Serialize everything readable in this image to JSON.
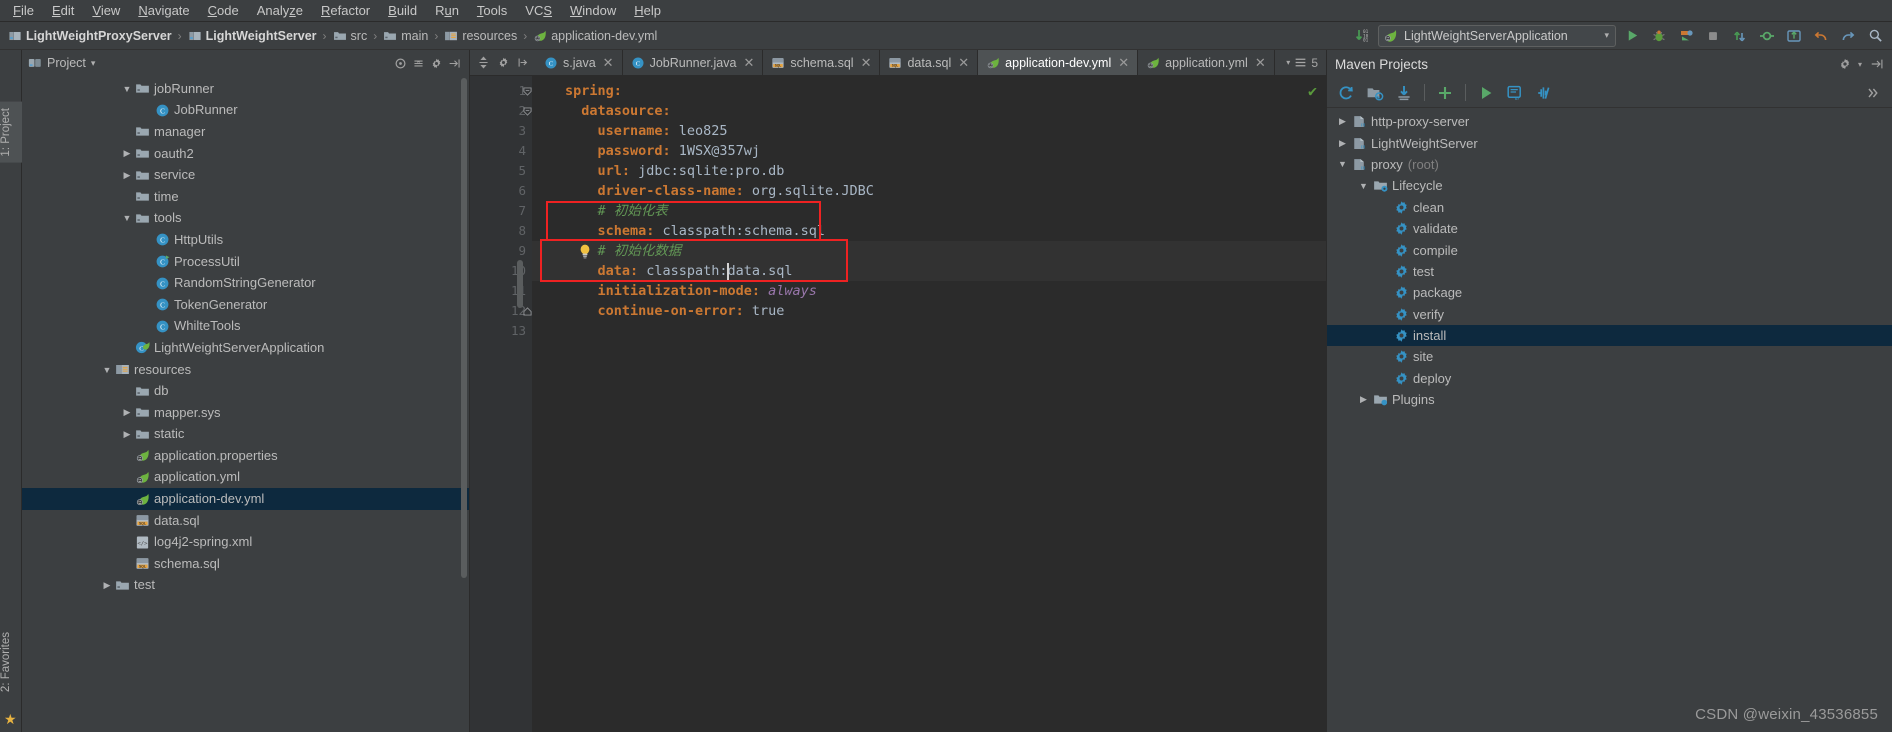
{
  "menu": {
    "items": [
      {
        "label": "File",
        "mnemonic": "F"
      },
      {
        "label": "Edit",
        "mnemonic": "E"
      },
      {
        "label": "View",
        "mnemonic": "V"
      },
      {
        "label": "Navigate",
        "mnemonic": "N"
      },
      {
        "label": "Code",
        "mnemonic": "C"
      },
      {
        "label": "Analyze",
        "mnemonic": "z"
      },
      {
        "label": "Refactor",
        "mnemonic": "R"
      },
      {
        "label": "Build",
        "mnemonic": "B"
      },
      {
        "label": "Run",
        "mnemonic": "u"
      },
      {
        "label": "Tools",
        "mnemonic": "T"
      },
      {
        "label": "VCS",
        "mnemonic": "S"
      },
      {
        "label": "Window",
        "mnemonic": "W"
      },
      {
        "label": "Help",
        "mnemonic": "H"
      }
    ]
  },
  "breadcrumb": {
    "items": [
      {
        "label": "LightWeightProxyServer",
        "icon": "module-icon",
        "bold": true
      },
      {
        "label": "LightWeightServer",
        "icon": "module-icon",
        "bold": true
      },
      {
        "label": "src",
        "icon": "folder-icon",
        "bold": false
      },
      {
        "label": "main",
        "icon": "folder-icon",
        "bold": false
      },
      {
        "label": "resources",
        "icon": "resources-folder-icon",
        "bold": false
      },
      {
        "label": "application-dev.yml",
        "icon": "spring-yml-icon",
        "bold": false
      }
    ],
    "separator": "›"
  },
  "toolbar": {
    "compile_icon": "compile-binary-icon",
    "run_config": {
      "name": "LightWeightServerApplication",
      "icon": "spring-boot-icon",
      "chevron": "▾"
    },
    "buttons": [
      {
        "name": "run-button",
        "icon": "play-icon",
        "color": "#5a9a3c"
      },
      {
        "name": "debug-button",
        "icon": "debug-icon",
        "color": "#cc7832"
      },
      {
        "name": "run-coverage-button",
        "icon": "coverage-icon",
        "color": "#cc7832"
      },
      {
        "name": "stop-button",
        "icon": "stop-icon",
        "color": "#8c8c8c"
      },
      {
        "name": "update-project-button",
        "icon": "vcs-update-icon",
        "color": "#499c54"
      },
      {
        "name": "commit-button",
        "icon": "vcs-commit-icon",
        "color": "#499c54"
      },
      {
        "name": "vcs-push-button",
        "icon": "vcs-push-icon",
        "color": "#6897bb"
      },
      {
        "name": "undo-button",
        "icon": "undo-icon",
        "color": "#cc7832"
      },
      {
        "name": "redo-button",
        "icon": "redo-icon",
        "color": "#6897bb"
      },
      {
        "name": "search-everywhere-button",
        "icon": "search-icon",
        "color": "#a9b7c6"
      }
    ]
  },
  "left_rail": {
    "tabs": [
      {
        "label": "1: Project",
        "active": true
      },
      {
        "label": "2: Favorites",
        "active": false
      }
    ],
    "bookmark_icon": "star-icon"
  },
  "project_panel": {
    "title": "Project",
    "chevron": "▾",
    "header_icons": [
      "settings-gear-icon",
      "collapse-all-icon",
      "options-gear-icon",
      "hide-panel-icon"
    ],
    "tree": [
      {
        "label": "jobRunner",
        "indent": 4,
        "arrow": "down",
        "icon": "folder"
      },
      {
        "label": "JobRunner",
        "indent": 5,
        "arrow": "none",
        "icon": "class"
      },
      {
        "label": "manager",
        "indent": 4,
        "arrow": "none",
        "icon": "folder"
      },
      {
        "label": "oauth2",
        "indent": 4,
        "arrow": "right",
        "icon": "folder"
      },
      {
        "label": "service",
        "indent": 4,
        "arrow": "right",
        "icon": "folder"
      },
      {
        "label": "time",
        "indent": 4,
        "arrow": "none",
        "icon": "folder"
      },
      {
        "label": "tools",
        "indent": 4,
        "arrow": "down",
        "icon": "folder"
      },
      {
        "label": "HttpUtils",
        "indent": 5,
        "arrow": "none",
        "icon": "class"
      },
      {
        "label": "ProcessUtil",
        "indent": 5,
        "arrow": "none",
        "icon": "class-run"
      },
      {
        "label": "RandomStringGenerator",
        "indent": 5,
        "arrow": "none",
        "icon": "class"
      },
      {
        "label": "TokenGenerator",
        "indent": 5,
        "arrow": "none",
        "icon": "class"
      },
      {
        "label": "WhilteTools",
        "indent": 5,
        "arrow": "none",
        "icon": "class"
      },
      {
        "label": "LightWeightServerApplication",
        "indent": 4,
        "arrow": "none",
        "icon": "spring-class"
      },
      {
        "label": "resources",
        "indent": 3,
        "arrow": "down",
        "icon": "resources-folder"
      },
      {
        "label": "db",
        "indent": 4,
        "arrow": "none",
        "icon": "folder"
      },
      {
        "label": "mapper.sys",
        "indent": 4,
        "arrow": "right",
        "icon": "folder"
      },
      {
        "label": "static",
        "indent": 4,
        "arrow": "right",
        "icon": "folder"
      },
      {
        "label": "application.properties",
        "indent": 4,
        "arrow": "none",
        "icon": "spring-file"
      },
      {
        "label": "application.yml",
        "indent": 4,
        "arrow": "none",
        "icon": "spring-file"
      },
      {
        "label": "application-dev.yml",
        "indent": 4,
        "arrow": "none",
        "icon": "spring-file",
        "selected": true
      },
      {
        "label": "data.sql",
        "indent": 4,
        "arrow": "none",
        "icon": "sql-file"
      },
      {
        "label": "log4j2-spring.xml",
        "indent": 4,
        "arrow": "none",
        "icon": "xml-file"
      },
      {
        "label": "schema.sql",
        "indent": 4,
        "arrow": "none",
        "icon": "sql-file"
      },
      {
        "label": "test",
        "indent": 3,
        "arrow": "right",
        "icon": "folder"
      }
    ]
  },
  "editor": {
    "tools": [
      "expand-collapse-icon",
      "settings-gear-icon",
      "select-opened-file-icon"
    ],
    "tabs": [
      {
        "label": "s.java",
        "icon": "java-class-icon",
        "active": false,
        "closable": true
      },
      {
        "label": "JobRunner.java",
        "icon": "java-class-icon",
        "active": false,
        "closable": true
      },
      {
        "label": "schema.sql",
        "icon": "sql-file-icon",
        "active": false,
        "closable": true
      },
      {
        "label": "data.sql",
        "icon": "sql-file-icon",
        "active": false,
        "closable": true
      },
      {
        "label": "application-dev.yml",
        "icon": "spring-yml-icon",
        "active": true,
        "closable": true
      },
      {
        "label": "application.yml",
        "icon": "spring-yml-icon",
        "active": false,
        "closable": true
      }
    ],
    "tab_overflow": {
      "chevron": "▾",
      "icon": "tab-list-icon",
      "count": "5"
    },
    "inspection_status": "ok",
    "inspection_glyph": "✔",
    "filename": "application-dev.yml",
    "lines": [
      {
        "num": "1",
        "indent": 0,
        "tokens": [
          {
            "t": "spring:",
            "c": "k"
          }
        ],
        "fold": "down"
      },
      {
        "num": "2",
        "indent": 1,
        "tokens": [
          {
            "t": "datasource:",
            "c": "k"
          }
        ],
        "fold": "down"
      },
      {
        "num": "3",
        "indent": 2,
        "tokens": [
          {
            "t": "username:",
            "c": "k"
          },
          {
            "t": " leo825",
            "c": "v"
          }
        ]
      },
      {
        "num": "4",
        "indent": 2,
        "tokens": [
          {
            "t": "password:",
            "c": "k"
          },
          {
            "t": " 1WSX@357wj",
            "c": "v"
          }
        ]
      },
      {
        "num": "5",
        "indent": 2,
        "tokens": [
          {
            "t": "url:",
            "c": "k"
          },
          {
            "t": " jdbc:sqlite:pro.db",
            "c": "v"
          }
        ]
      },
      {
        "num": "6",
        "indent": 2,
        "tokens": [
          {
            "t": "driver-class-name:",
            "c": "k"
          },
          {
            "t": " org.sqlite.JDBC",
            "c": "v"
          }
        ]
      },
      {
        "num": "7",
        "indent": 2,
        "tokens": [
          {
            "t": "# 初始化表",
            "c": "cm"
          }
        ]
      },
      {
        "num": "8",
        "indent": 2,
        "tokens": [
          {
            "t": "schema:",
            "c": "k"
          },
          {
            "t": " classpath:schema.sql",
            "c": "v"
          }
        ]
      },
      {
        "num": "9",
        "indent": 2,
        "tokens": [
          {
            "t": "# 初始化数据",
            "c": "cm"
          }
        ],
        "bulb": true,
        "highlight": true
      },
      {
        "num": "10",
        "indent": 2,
        "tokens": [
          {
            "t": "data:",
            "c": "k"
          },
          {
            "t": " classpath:data.sql",
            "c": "v"
          }
        ],
        "highlight": true,
        "caret_after": "data: classpath:"
      },
      {
        "num": "11",
        "indent": 2,
        "tokens": [
          {
            "t": "initialization-mode:",
            "c": "k"
          },
          {
            "t": " always",
            "c": "it"
          }
        ]
      },
      {
        "num": "12",
        "indent": 2,
        "tokens": [
          {
            "t": "continue-on-error:",
            "c": "k"
          },
          {
            "t": " true",
            "c": "v"
          }
        ],
        "fold": "up"
      },
      {
        "num": "13",
        "indent": 0,
        "tokens": []
      }
    ],
    "annotations": [
      {
        "name": "red-highlight-box-schema",
        "color": "#ee2222",
        "lines": "7-8"
      },
      {
        "name": "red-highlight-box-data",
        "color": "#ee2222",
        "lines": "9-10"
      }
    ]
  },
  "maven_panel": {
    "title": "Maven Projects",
    "header_icons": [
      "settings-gear-icon",
      "hide-panel-icon"
    ],
    "toolbar": [
      {
        "name": "reimport-button",
        "icon": "refresh-icon"
      },
      {
        "name": "generate-sources-button",
        "icon": "generate-sources-icon"
      },
      {
        "name": "download-sources-button",
        "icon": "download-icon"
      },
      {
        "name": "add-maven-project-button",
        "icon": "plus-icon"
      },
      {
        "name": "run-maven-build-button",
        "icon": "play-icon"
      },
      {
        "name": "execute-goal-button",
        "icon": "execute-goal-icon"
      },
      {
        "name": "toggle-offline-button",
        "icon": "offline-icon"
      },
      {
        "name": "more-button",
        "icon": "chevron-double-right-icon"
      }
    ],
    "tree": [
      {
        "label": "http-proxy-server",
        "indent": 0,
        "arrow": "right",
        "icon": "maven-module"
      },
      {
        "label": "LightWeightServer",
        "indent": 0,
        "arrow": "right",
        "icon": "maven-module"
      },
      {
        "label": "proxy",
        "suffix": "(root)",
        "indent": 0,
        "arrow": "down",
        "icon": "maven-module"
      },
      {
        "label": "Lifecycle",
        "indent": 1,
        "arrow": "down",
        "icon": "lifecycle-folder"
      },
      {
        "label": "clean",
        "indent": 2,
        "arrow": "none",
        "icon": "goal"
      },
      {
        "label": "validate",
        "indent": 2,
        "arrow": "none",
        "icon": "goal"
      },
      {
        "label": "compile",
        "indent": 2,
        "arrow": "none",
        "icon": "goal"
      },
      {
        "label": "test",
        "indent": 2,
        "arrow": "none",
        "icon": "goal"
      },
      {
        "label": "package",
        "indent": 2,
        "arrow": "none",
        "icon": "goal"
      },
      {
        "label": "verify",
        "indent": 2,
        "arrow": "none",
        "icon": "goal"
      },
      {
        "label": "install",
        "indent": 2,
        "arrow": "none",
        "icon": "goal",
        "selected": true
      },
      {
        "label": "site",
        "indent": 2,
        "arrow": "none",
        "icon": "goal"
      },
      {
        "label": "deploy",
        "indent": 2,
        "arrow": "none",
        "icon": "goal"
      },
      {
        "label": "Plugins",
        "indent": 1,
        "arrow": "right",
        "icon": "plugins-folder"
      }
    ]
  },
  "watermark": "CSDN @weixin_43536855",
  "colors": {
    "background": "#3c3f41",
    "editor_bg": "#2b2b2b",
    "gutter_bg": "#313335",
    "selection": "#0d293e",
    "accent_orange": "#cc7832",
    "accent_green": "#629755",
    "annotation_red": "#ee2222",
    "text": "#bbbbbb"
  }
}
